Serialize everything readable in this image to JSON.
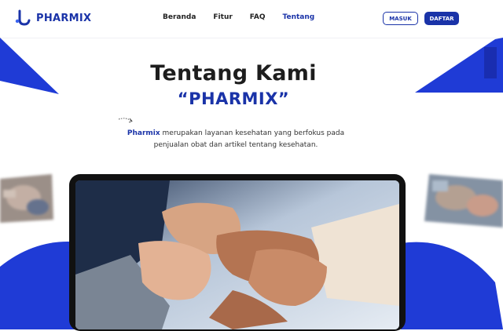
{
  "brand": {
    "name": "PHARMIX"
  },
  "nav": {
    "items": [
      {
        "label": "Beranda",
        "active": false
      },
      {
        "label": "Fitur",
        "active": false
      },
      {
        "label": "FAQ",
        "active": false
      },
      {
        "label": "Tentang",
        "active": true
      }
    ]
  },
  "auth": {
    "login_label": "MASUK",
    "register_label": "DAFTAR"
  },
  "hero": {
    "title": "Tentang Kami",
    "subtitle": "“PHARMIX”",
    "desc_brand": "Pharmix",
    "desc_line1_rest": " merupakan layanan kesehatan yang berfokus pada",
    "desc_line2": "penjualan obat dan artikel tentang kesehatan."
  },
  "colors": {
    "primary": "#1a33a8",
    "accent_blue": "#1f3bd6"
  }
}
